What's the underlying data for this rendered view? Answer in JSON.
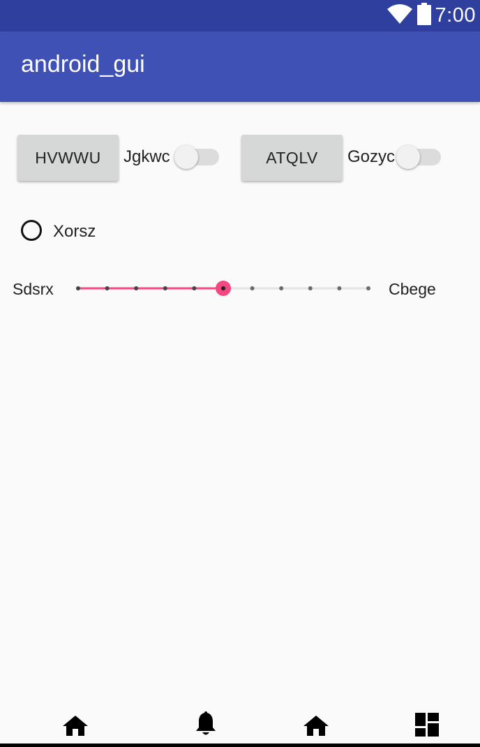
{
  "status_bar": {
    "time": "7:00",
    "icons": [
      "wifi-icon",
      "battery-icon"
    ],
    "background": "#2f3f9e"
  },
  "app_bar": {
    "title": "android_gui",
    "background": "#3f51b5"
  },
  "row1": {
    "button1_label": "HVWWU",
    "switch1_label": "Jgkwc",
    "switch1_on": false,
    "button2_label": "ATQLV",
    "switch2_label": "Gozyc",
    "switch2_on": false
  },
  "radio": {
    "label": "Xorsz",
    "checked": false
  },
  "seekbar": {
    "left_label": "Sdsrx",
    "right_label": "Cbege",
    "max": 10,
    "progress": 5,
    "accent_color": "#f54781"
  },
  "bottom_nav": {
    "icons": [
      "home-icon",
      "notifications-icon",
      "home-icon",
      "dashboard-icon"
    ]
  }
}
